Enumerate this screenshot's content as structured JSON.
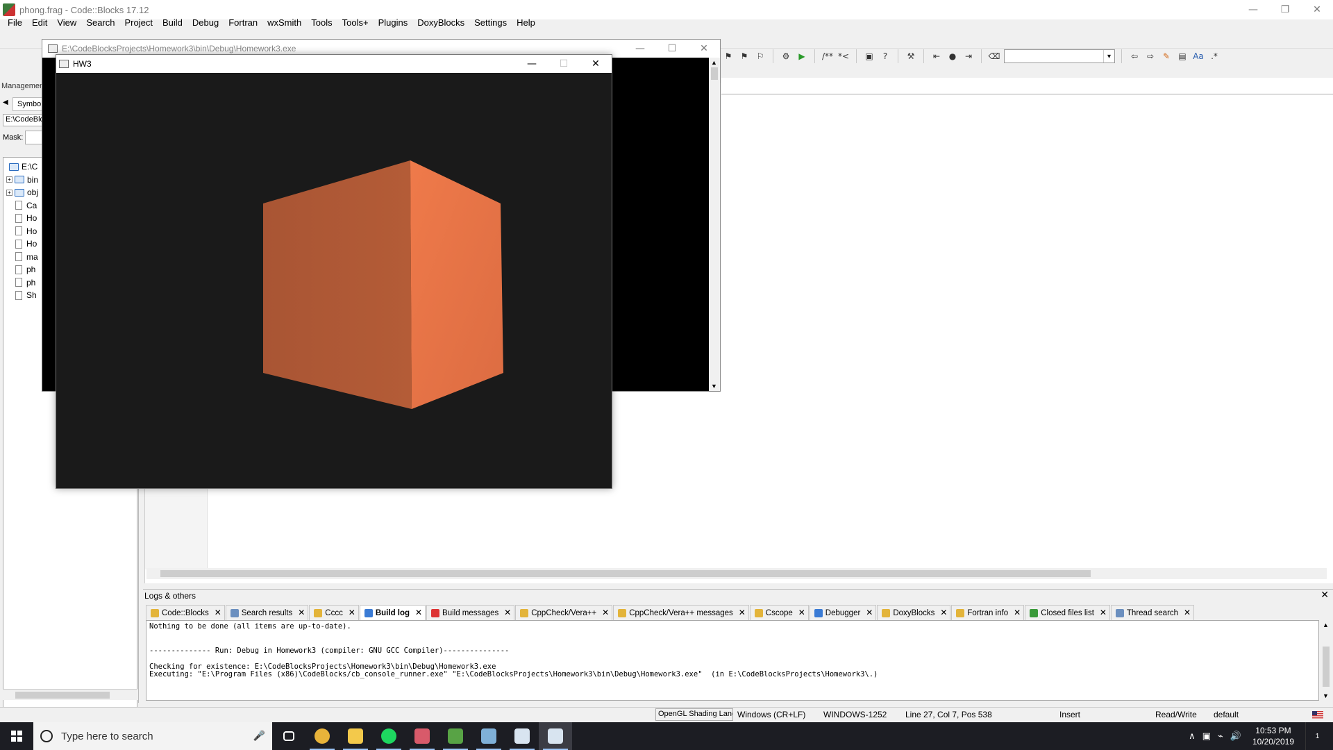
{
  "app": {
    "title": "phong.frag - Code::Blocks 17.12"
  },
  "menu": [
    "File",
    "Edit",
    "View",
    "Search",
    "Project",
    "Build",
    "Debug",
    "Fortran",
    "wxSmith",
    "Tools",
    "Tools+",
    "Plugins",
    "DoxyBlocks",
    "Settings",
    "Help"
  ],
  "toolbar2": {
    "icons": [
      "bookmark-prev-icon",
      "bookmark-next-icon",
      "bookmark-clear-icon",
      "sep",
      "compile-icon",
      "run-icon",
      "sep",
      "comment-block-icon",
      "comment-line-icon",
      "sep",
      "doxy-html-icon",
      "doxy-help-icon",
      "sep",
      "wrench-icon",
      "sep",
      "jump-back-icon",
      "jump-dot-icon",
      "jump-forward-icon",
      "sep",
      "search-clear-icon",
      "combo",
      "sep",
      "arrow-left-icon",
      "arrow-right-icon",
      "highlight-icon",
      "select-icon",
      "text-icon",
      "regex-icon"
    ],
    "glyphs": {
      "comment-block-icon": "/**",
      "comment-line-icon": "*<",
      "text-icon": "Aa",
      "regex-icon": ".*"
    }
  },
  "management": {
    "title": "Management",
    "tab_label": "Symbols",
    "path": "E:\\CodeBlocks",
    "mask_label": "Mask:",
    "tree": [
      {
        "label": "E:\\C",
        "type": "root-folder",
        "depth": 0
      },
      {
        "label": "bin",
        "type": "folder",
        "depth": 1
      },
      {
        "label": "obj",
        "type": "folder",
        "depth": 1
      },
      {
        "label": "Ca",
        "type": "file",
        "depth": 1
      },
      {
        "label": "Ho",
        "type": "file",
        "depth": 1
      },
      {
        "label": "Ho",
        "type": "file",
        "depth": 1
      },
      {
        "label": "Ho",
        "type": "file",
        "depth": 1
      },
      {
        "label": "ma",
        "type": "file",
        "depth": 1
      },
      {
        "label": "ph",
        "type": "file",
        "depth": 1
      },
      {
        "label": "ph",
        "type": "file",
        "depth": 1
      },
      {
        "label": "Sh",
        "type": "file",
        "depth": 1
      }
    ]
  },
  "console_window": {
    "title": "E:\\CodeBlocksProjects\\Homework3\\bin\\Debug\\Homework3.exe"
  },
  "hw3_window": {
    "title": "HW3",
    "background": "#1a1a1a",
    "cube": {
      "left_face_color": "#b05a35",
      "right_face_color": "#e97548"
    }
  },
  "logs": {
    "title": "Logs & others",
    "tabs": [
      {
        "label": "Code::Blocks",
        "icon": "pencil-icon",
        "active": false
      },
      {
        "label": "Search results",
        "icon": "search-icon",
        "active": false
      },
      {
        "label": "Cccc",
        "icon": "pencil-icon",
        "active": false
      },
      {
        "label": "Build log",
        "icon": "gear-icon",
        "active": true
      },
      {
        "label": "Build messages",
        "icon": "pin-icon",
        "active": false
      },
      {
        "label": "CppCheck/Vera++",
        "icon": "pencil-icon",
        "active": false
      },
      {
        "label": "CppCheck/Vera++ messages",
        "icon": "pencil-icon",
        "active": false
      },
      {
        "label": "Cscope",
        "icon": "pencil-icon",
        "active": false
      },
      {
        "label": "Debugger",
        "icon": "gear-icon",
        "active": false
      },
      {
        "label": "DoxyBlocks",
        "icon": "pencil-icon",
        "active": false
      },
      {
        "label": "Fortran info",
        "icon": "pencil-icon",
        "active": false
      },
      {
        "label": "Closed files list",
        "icon": "refresh-icon",
        "active": false
      },
      {
        "label": "Thread search",
        "icon": "search-icon",
        "active": false
      }
    ],
    "lines": [
      "Nothing to be done (all items are up-to-date).",
      "",
      "",
      "-------------- Run: Debug in Homework3 (compiler: GNU GCC Compiler)---------------",
      "",
      "Checking for existence: E:\\CodeBlocksProjects\\Homework3\\bin\\Debug\\Homework3.exe",
      "Executing: \"E:\\Program Files (x86)\\CodeBlocks/cb_console_runner.exe\" \"E:\\CodeBlocksProjects\\Homework3\\bin\\Debug\\Homework3.exe\"  (in E:\\CodeBlocksProjects\\Homework3\\.)"
    ]
  },
  "status": {
    "language": "OpenGL Shading Language",
    "eol": "Windows (CR+LF)",
    "encoding": "WINDOWS-1252",
    "position": "Line 27, Col 7, Pos 538",
    "mode": "Insert",
    "access": "Read/Write",
    "profile": "default"
  },
  "taskbar": {
    "search_placeholder": "Type here to search",
    "apps": [
      {
        "name": "task-view",
        "color": "#ffffff",
        "running": false,
        "active": false
      },
      {
        "name": "chrome",
        "color": "#e8b33a",
        "running": true,
        "active": false
      },
      {
        "name": "file-explorer",
        "color": "#f3c94b",
        "running": true,
        "active": false
      },
      {
        "name": "spotify",
        "color": "#1ed760",
        "running": true,
        "active": false
      },
      {
        "name": "discord",
        "color": "#d85a6a",
        "running": true,
        "active": false
      },
      {
        "name": "codeblocks",
        "color": "#58a345",
        "running": true,
        "active": false
      },
      {
        "name": "paint",
        "color": "#7fb0d8",
        "running": true,
        "active": false
      },
      {
        "name": "app-window",
        "color": "#d8e4f0",
        "running": true,
        "active": false
      },
      {
        "name": "app-window-active",
        "color": "#d8e4f0",
        "running": true,
        "active": true
      }
    ],
    "time": "10:53 PM",
    "date": "10/20/2019",
    "notification_count": "1"
  }
}
